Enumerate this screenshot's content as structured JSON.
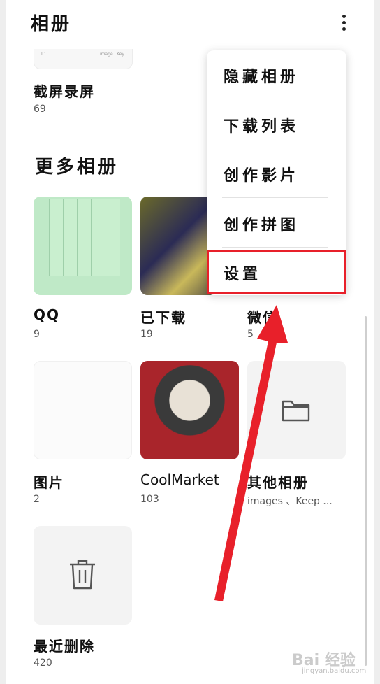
{
  "header": {
    "title": "相册"
  },
  "top_album": {
    "name": "截屏录屏",
    "count": "69",
    "thumb_text": [
      "ID",
      "image",
      "Key"
    ]
  },
  "section_title": "更多相册",
  "albums": [
    {
      "name": "QQ",
      "count": "9"
    },
    {
      "name": "已下载",
      "count": "19"
    },
    {
      "name": "微信",
      "count": "5"
    },
    {
      "name": "图片",
      "count": "2"
    },
    {
      "name": "CoolMarket",
      "count": "103"
    },
    {
      "name": "其他相册",
      "count": "images 、Keep ..."
    },
    {
      "name": "最近删除",
      "count": "420"
    }
  ],
  "menu": {
    "items": [
      "隐藏相册",
      "下载列表",
      "创作影片",
      "创作拼图",
      "设置"
    ],
    "highlighted": "设置"
  },
  "annotation": {
    "color": "#e8202a"
  },
  "watermark": {
    "text": "Bai 经验",
    "sub": "jingyan.baidu.com"
  },
  "icons": {
    "more": "more-vertical-icon",
    "folder": "folder-icon",
    "trash": "trash-icon"
  }
}
